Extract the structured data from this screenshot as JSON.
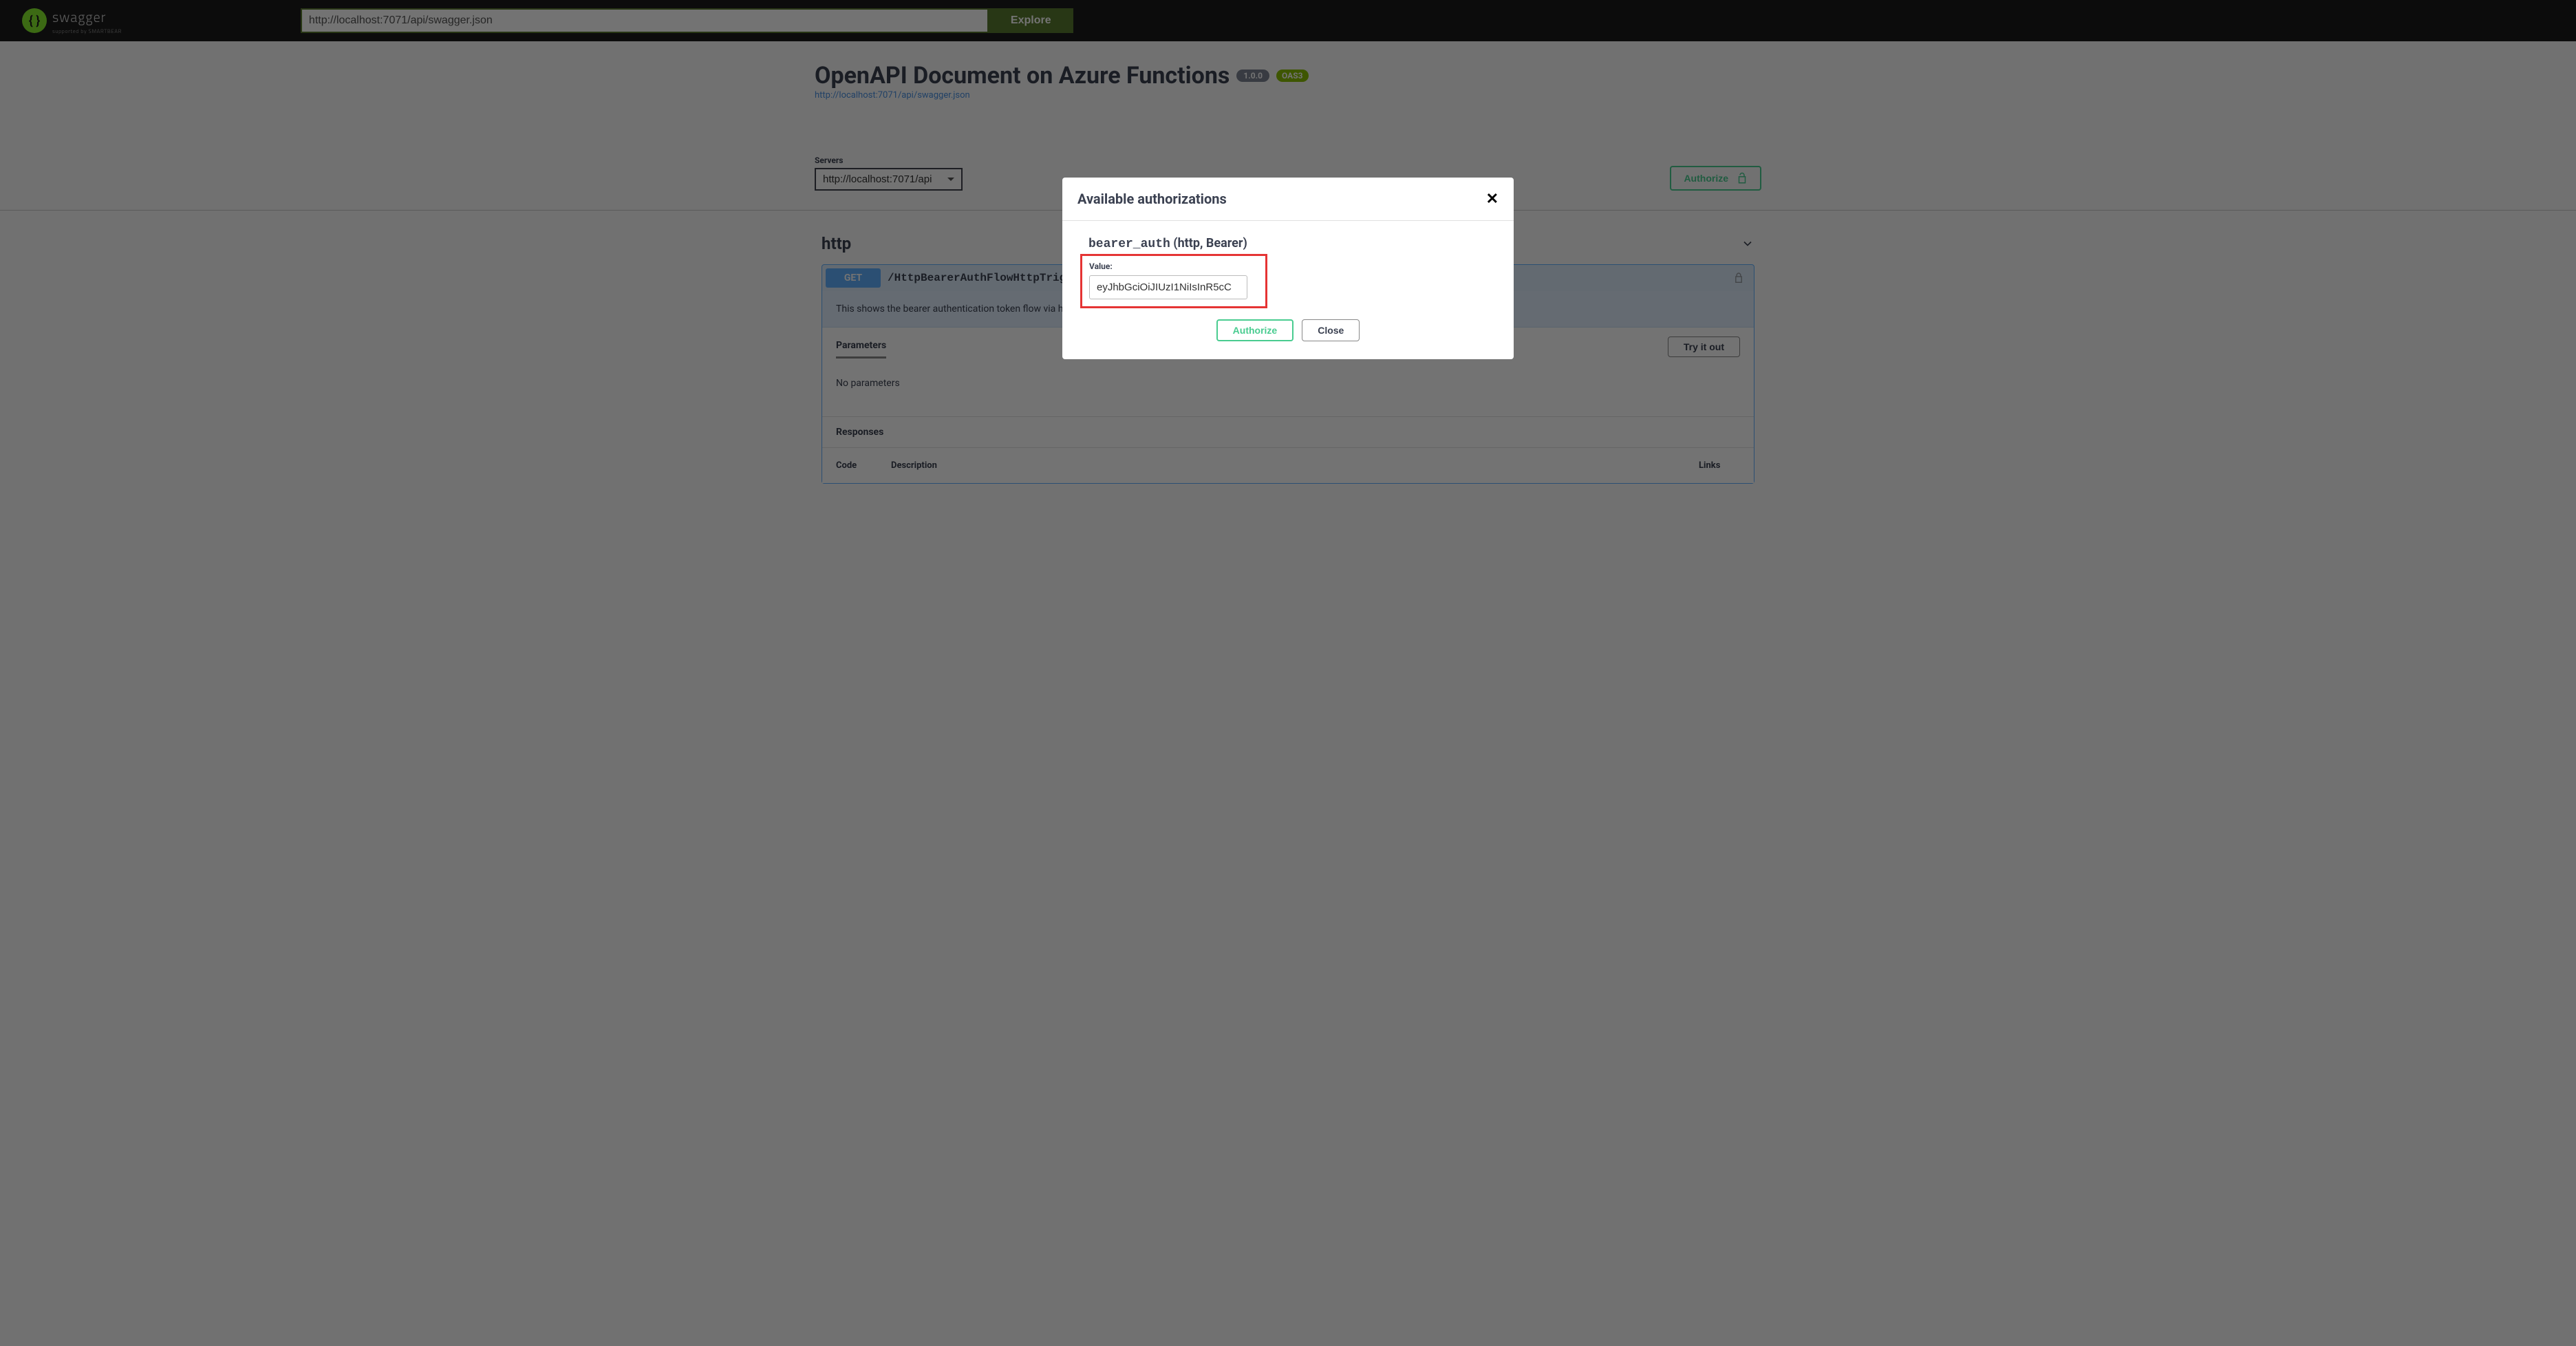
{
  "topbar": {
    "logo_main": "swagger",
    "logo_sub": "supported by SMARTBEAR",
    "spec_input": "http://localhost:7071/api/swagger.json",
    "explore_label": "Explore"
  },
  "info": {
    "title": "OpenAPI Document on Azure Functions",
    "version": "1.0.0",
    "oas_badge": "OAS3",
    "spec_url": "http://localhost:7071/api/swagger.json"
  },
  "servers": {
    "label": "Servers",
    "selected": "http://localhost:7071/api"
  },
  "authorize_btn": "Authorize",
  "tag": {
    "name": "http",
    "op": {
      "method": "GET",
      "path": "/HttpBearerAuthFlowHttpTrigger",
      "description": "This shows the bearer authentication token flow via header",
      "params_title": "Parameters",
      "tryout": "Try it out",
      "no_params": "No parameters",
      "responses_title": "Responses",
      "col_code": "Code",
      "col_desc": "Description",
      "col_links": "Links"
    }
  },
  "modal": {
    "title": "Available authorizations",
    "scheme_name": "bearer_auth",
    "scheme_meta": "  (http, Bearer)",
    "value_label": "Value:",
    "value_input": "eyJhbGciOiJIUzI1NiIsInR5cC",
    "authorize": "Authorize",
    "close": "Close"
  }
}
